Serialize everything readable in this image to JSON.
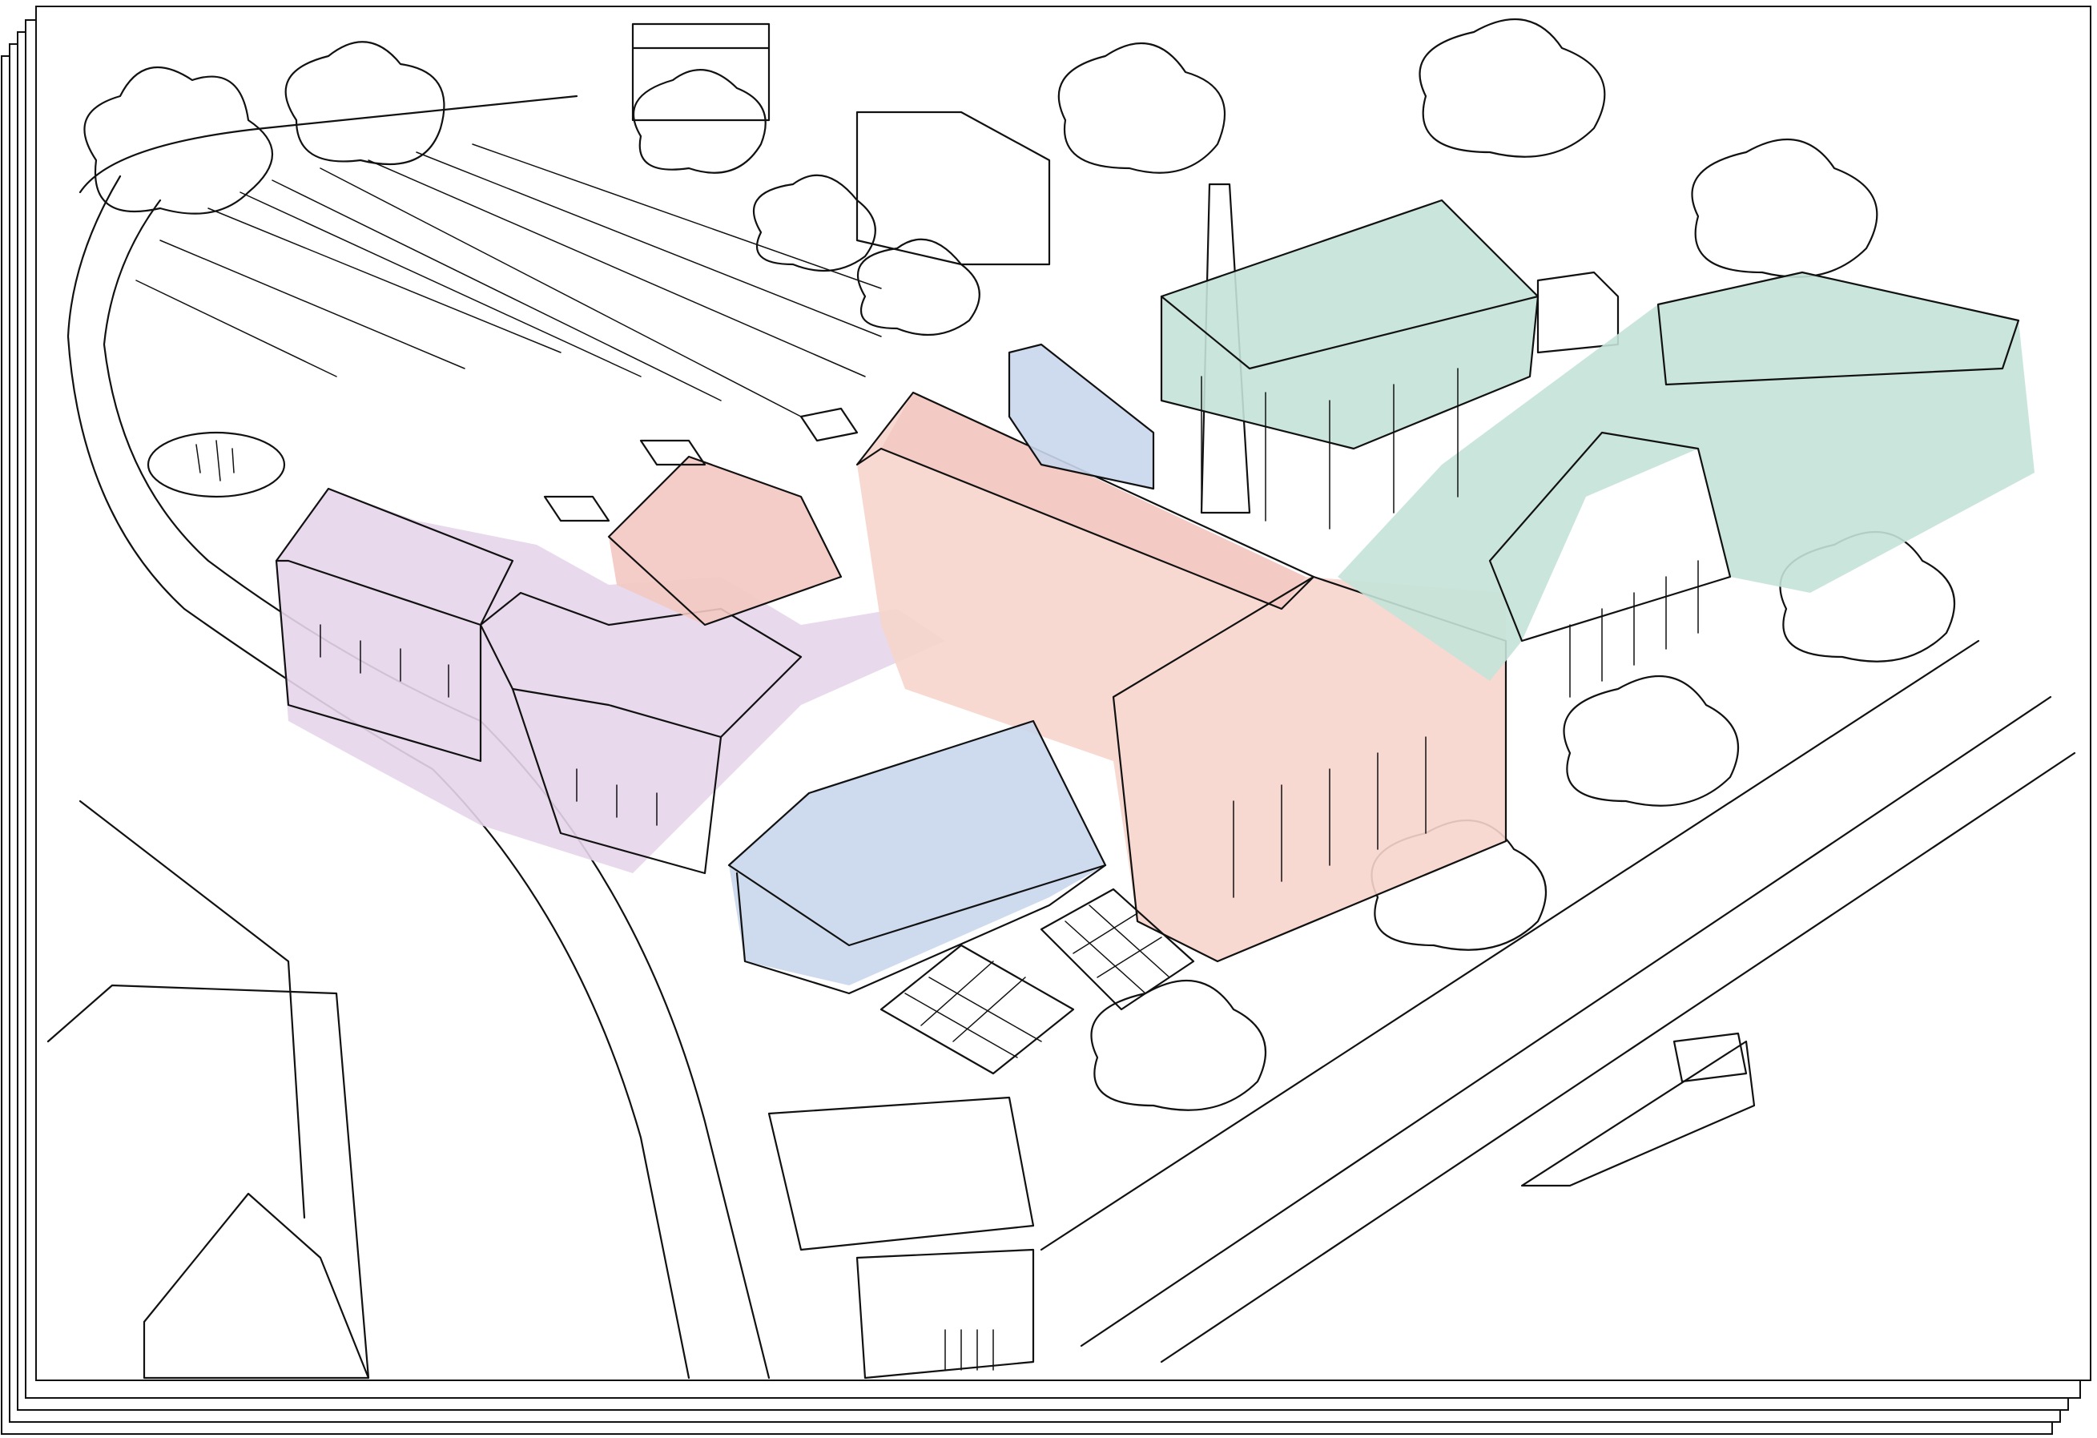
{
  "colors": {
    "paper": "#ffffff",
    "ink": "#111111",
    "purple_wash": "#e6d6ea",
    "pink_wash": "#f6d5cc",
    "salmon_wash": "#f3c8c2",
    "blue_wash": "#c9d6ec",
    "green_wash": "#c4e3d8"
  },
  "layers": {
    "stacked_sheets": 5,
    "building_groups": [
      "purple-terrace",
      "pink-mill-hall",
      "blue-cottages",
      "green-warehouses"
    ]
  }
}
